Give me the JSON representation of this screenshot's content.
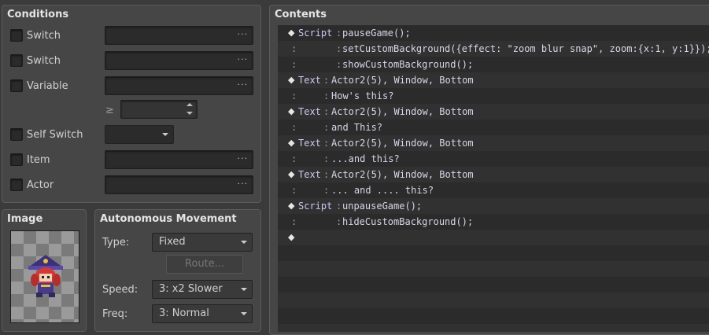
{
  "conditions": {
    "title": "Conditions",
    "switch1_label": "Switch",
    "switch2_label": "Switch",
    "variable_label": "Variable",
    "operator": "≥",
    "self_switch_label": "Self Switch",
    "item_label": "Item",
    "actor_label": "Actor",
    "ellipsis": "···"
  },
  "image": {
    "title": "Image"
  },
  "movement": {
    "title": "Autonomous Movement",
    "type_label": "Type:",
    "type_value": "Fixed",
    "route_label": "Route...",
    "speed_label": "Speed:",
    "speed_value": "3: x2 Slower",
    "freq_label": "Freq:",
    "freq_value": "3: Normal"
  },
  "contents": {
    "title": "Contents",
    "rows": [
      {
        "diamond": "◆",
        "cmd": "Script",
        "colon": ":",
        "text": "pauseGame();"
      },
      {
        "diamond": ":",
        "cmd": "      ",
        "colon": ":",
        "text": "setCustomBackground({effect: \"zoom blur snap\", zoom:{x:1, y:1}});"
      },
      {
        "diamond": ":",
        "cmd": "      ",
        "colon": ":",
        "text": "showCustomBackground();"
      },
      {
        "diamond": "◆",
        "cmd": "Text",
        "colon": ":",
        "text": "Actor2(5), Window, Bottom"
      },
      {
        "diamond": ":",
        "cmd": "    ",
        "colon": ":",
        "text": "How's this?"
      },
      {
        "diamond": "◆",
        "cmd": "Text",
        "colon": ":",
        "text": "Actor2(5), Window, Bottom"
      },
      {
        "diamond": ":",
        "cmd": "    ",
        "colon": ":",
        "text": "and This?"
      },
      {
        "diamond": "◆",
        "cmd": "Text",
        "colon": ":",
        "text": "Actor2(5), Window, Bottom"
      },
      {
        "diamond": ":",
        "cmd": "    ",
        "colon": ":",
        "text": "...and this?"
      },
      {
        "diamond": "◆",
        "cmd": "Text",
        "colon": ":",
        "text": "Actor2(5), Window, Bottom"
      },
      {
        "diamond": ":",
        "cmd": "    ",
        "colon": ":",
        "text": "... and .... this?"
      },
      {
        "diamond": "◆",
        "cmd": "Script",
        "colon": ":",
        "text": "unpauseGame();"
      },
      {
        "diamond": ":",
        "cmd": "      ",
        "colon": ":",
        "text": "hideCustomBackground();"
      },
      {
        "diamond": "◆",
        "cmd": "",
        "colon": "",
        "text": ""
      }
    ]
  }
}
